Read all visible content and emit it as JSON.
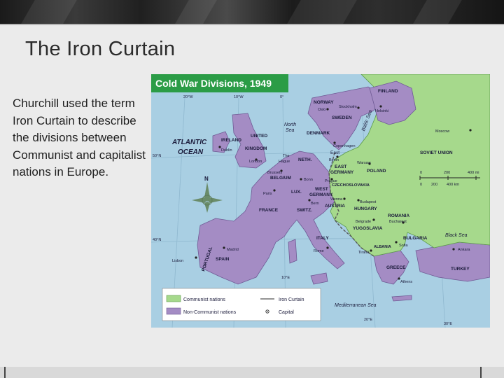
{
  "slide": {
    "title": "The Iron Curtain",
    "body": "Churchill used the term Iron Curtain to describe the divisions between Communist and capitalist nations in Europe."
  },
  "map": {
    "title": "Cold War Divisions, 1949",
    "colors": {
      "communist": "#a6d98c",
      "non_communist": "#a48cc4",
      "sea": "#a9cfe3",
      "title_bg": "#2b9c46",
      "iron_curtain": "#555555"
    },
    "legend": {
      "communist": "Communist nations",
      "non_communist": "Non-Communist nations",
      "iron_curtain": "Iron Curtain",
      "capital": "Capital"
    },
    "graticule": {
      "lon_20w": "20°W",
      "lon_10w": "10°W",
      "lon_0": "0°",
      "lon_10e": "10°E",
      "lon_20e": "20°E",
      "lon_30e": "30°E",
      "lat_50n": "50°N",
      "lat_40n": "40°N"
    },
    "compass_north": "N",
    "scale": {
      "marks_top": [
        "0",
        "200",
        "400 mi"
      ],
      "marks_bottom": [
        "0",
        "200",
        "400 km"
      ]
    },
    "seas": {
      "atlantic_1": "ATLANTIC",
      "atlantic_2": "OCEAN",
      "north_sea_1": "North",
      "north_sea_2": "Sea",
      "baltic": "Baltic Sea",
      "black_sea": "Black Sea",
      "mediterranean": "Mediterranean Sea"
    },
    "countries": {
      "finland": "FINLAND",
      "norway": "NORWAY",
      "sweden": "SWEDEN",
      "denmark": "DENMARK",
      "ireland": "IRELAND",
      "uk_1": "UNITED",
      "uk_2": "KINGDOM",
      "neth": "NETH.",
      "belgium": "BELGIUM",
      "lux": "LUX.",
      "east_germany_1": "EAST",
      "east_germany_2": "GERMANY",
      "west_germany_1": "WEST",
      "west_germany_2": "GERMANY",
      "poland": "POLAND",
      "soviet_union": "SOVIET UNION",
      "czechoslovakia": "CZECHOSLOVAKIA",
      "austria": "AUSTRIA",
      "hungary": "HUNGARY",
      "romania": "ROMANIA",
      "france": "FRANCE",
      "switz": "SWITZ.",
      "italy": "ITALY",
      "yugoslavia": "YUGOSLAVIA",
      "bulgaria": "BULGARIA",
      "albania": "ALBANIA",
      "greece": "GREECE",
      "turkey": "TURKEY",
      "portugal": "PORTUGAL",
      "spain": "SPAIN",
      "east": "East"
    },
    "capitals": {
      "oslo": "Oslo",
      "stockholm": "Stockholm",
      "helsinki": "Helsinki",
      "moscow": "Moscow",
      "dublin": "Dublin",
      "london": "London",
      "the": "The",
      "hague": "Hague",
      "copenhagen": "Copenhagen",
      "brussels": "Brussels",
      "berlin": "Berlin",
      "warsaw": "Warsaw",
      "bonn": "Bonn",
      "prague": "Prague",
      "paris": "Paris",
      "vienna": "Vienna",
      "budapest": "Budapest",
      "bern": "Bern",
      "belgrade": "Belgrade",
      "bucharest": "Bucharest",
      "sofia": "Sofia",
      "rome": "Rome",
      "tirane": "Tiranë",
      "madrid": "Madrid",
      "lisbon": "Lisbon",
      "ankara": "Ankara",
      "athens": "Athens"
    }
  }
}
